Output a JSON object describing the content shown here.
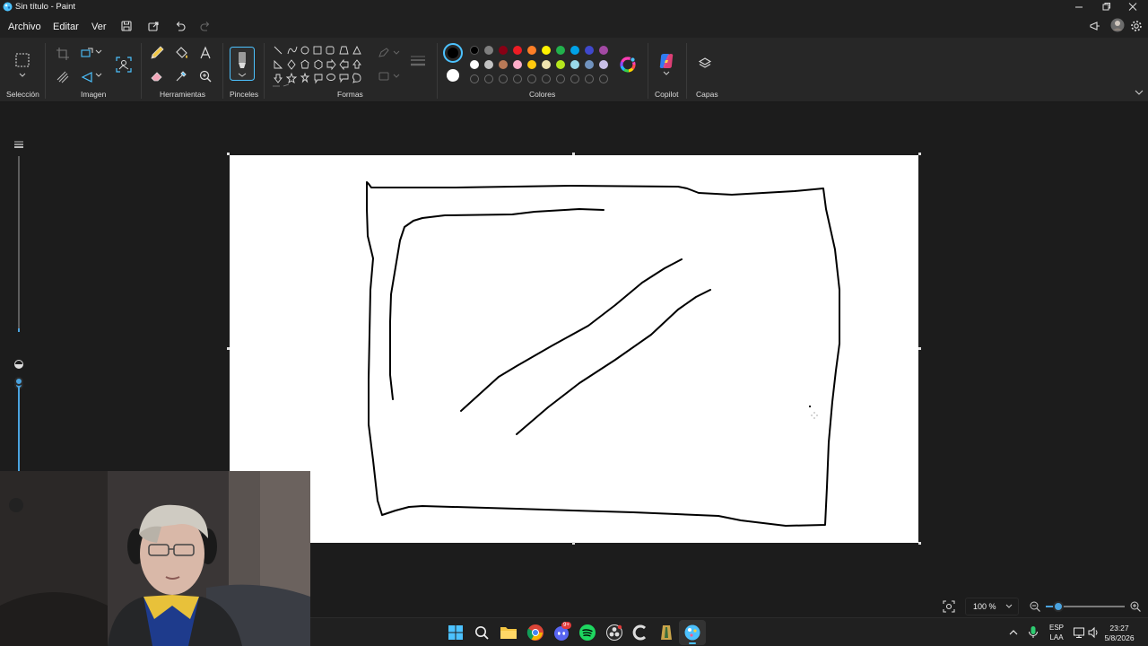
{
  "window": {
    "title": "Sin título - Paint"
  },
  "menu": {
    "file_label": "Archivo",
    "edit_label": "Editar",
    "view_label": "Ver"
  },
  "ribbon": {
    "groups": {
      "selection": "Selección",
      "image": "Imagen",
      "tools": "Herramientas",
      "brushes": "Pinceles",
      "shapes": "Formas",
      "colors": "Colores",
      "copilot": "Copilot",
      "layers": "Capas"
    },
    "colors_row1": [
      "#000000",
      "#7f7f7f",
      "#880015",
      "#ed1c24",
      "#ff7f27",
      "#fff200",
      "#22b14c",
      "#00a2e8",
      "#3f48cc",
      "#a349a4"
    ],
    "colors_row2": [
      "#ffffff",
      "#c3c3c3",
      "#b97a57",
      "#ffaec9",
      "#ffc90e",
      "#efe4b0",
      "#b5e61d",
      "#99d9ea",
      "#7092be",
      "#c8bfe7"
    ],
    "primary_color": "#000000",
    "secondary_color": "#ffffff"
  },
  "status": {
    "zoom": "100 %"
  },
  "taskbar": {
    "icons": [
      "windows-start",
      "search",
      "file-explorer",
      "chrome",
      "discord",
      "spotify",
      "obs",
      "ccleaner",
      "app",
      "paint"
    ],
    "discord_badge": "9+",
    "lang_top": "ESP",
    "lang_bottom": "LAA",
    "time": "23:27",
    "date": "5/8/2026"
  }
}
